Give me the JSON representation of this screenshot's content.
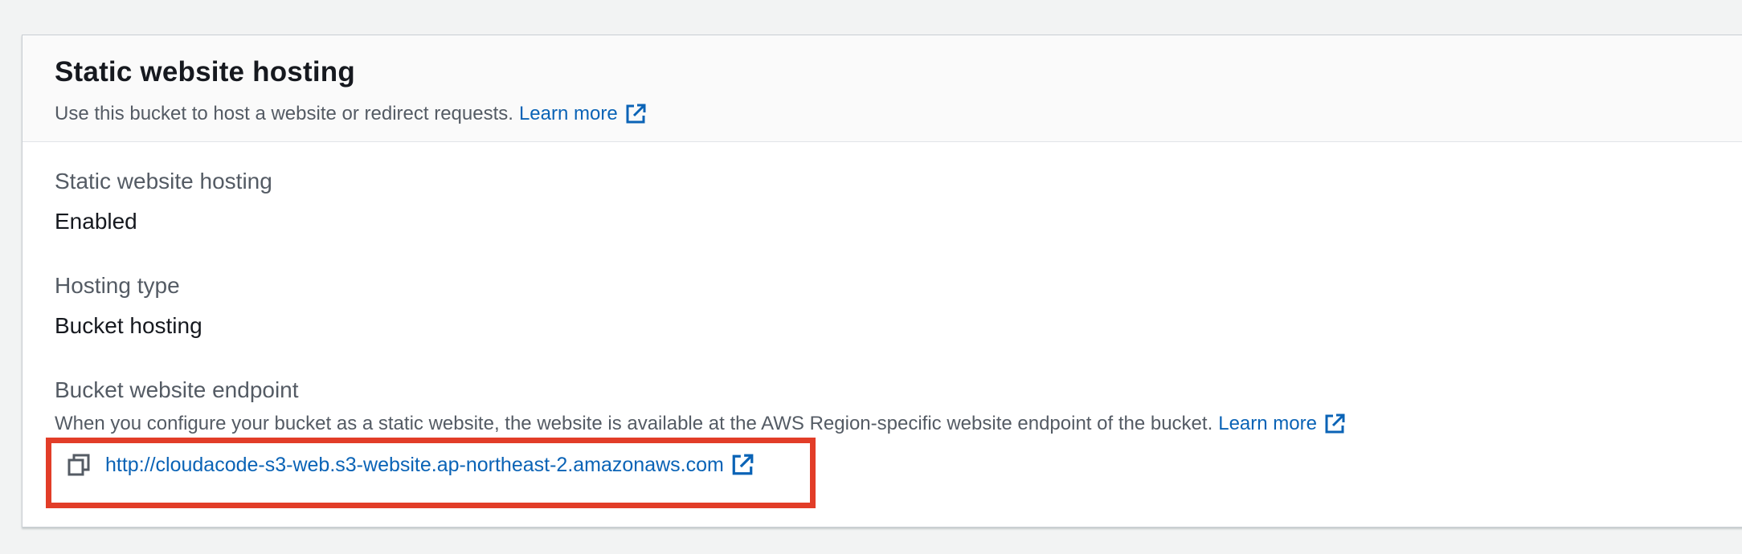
{
  "section": {
    "title": "Static website hosting",
    "description": "Use this bucket to host a website or redirect requests.",
    "learn_more": "Learn more"
  },
  "fields": {
    "hosting_status": {
      "label": "Static website hosting",
      "value": "Enabled"
    },
    "hosting_type": {
      "label": "Hosting type",
      "value": "Bucket hosting"
    },
    "endpoint": {
      "label": "Bucket website endpoint",
      "description": "When you configure your bucket as a static website, the website is available at the AWS Region-specific website endpoint of the bucket.",
      "learn_more": "Learn more",
      "url": "http://cloudacode-s3-web.s3-website.ap-northeast-2.amazonaws.com"
    }
  },
  "icons": {
    "external_link": "external-link-icon",
    "copy": "copy-icon"
  },
  "colors": {
    "link": "#0a63b6",
    "highlight": "#e23d28",
    "header_bg": "#fafafa",
    "page_bg": "#f2f3f3"
  }
}
